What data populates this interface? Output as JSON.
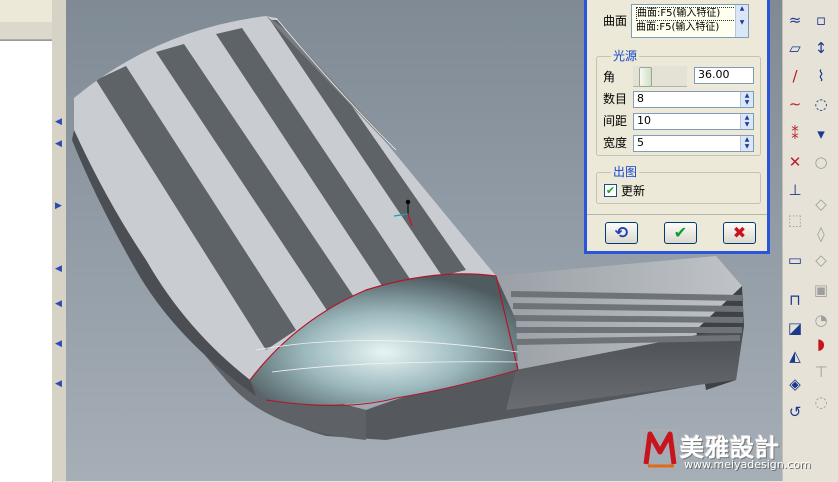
{
  "dialog": {
    "surface_label": "曲面",
    "surface_items": [
      "曲面:F5(输入特征)",
      "曲面:F5(输入特征)"
    ],
    "light_group_title": "光源",
    "angle_label": "角",
    "angle_value": "36.00",
    "count_label": "数目",
    "count_value": "8",
    "spacing_label": "间距",
    "spacing_value": "10",
    "width_label": "宽度",
    "width_value": "5",
    "output_group_title": "出图",
    "update_label": "更新",
    "update_checked": true,
    "buttons": {
      "refresh_icon": "refresh-icon",
      "ok_icon": "check-icon",
      "cancel_icon": "x-icon"
    }
  },
  "watermark": {
    "brand": "美雅設計",
    "url": "www.meiyadesign.com"
  },
  "colors": {
    "dialog_border": "#2a55d8",
    "group_title": "#1545c8",
    "ok_green": "#0c9c2c",
    "cancel_red": "#c8141c"
  }
}
